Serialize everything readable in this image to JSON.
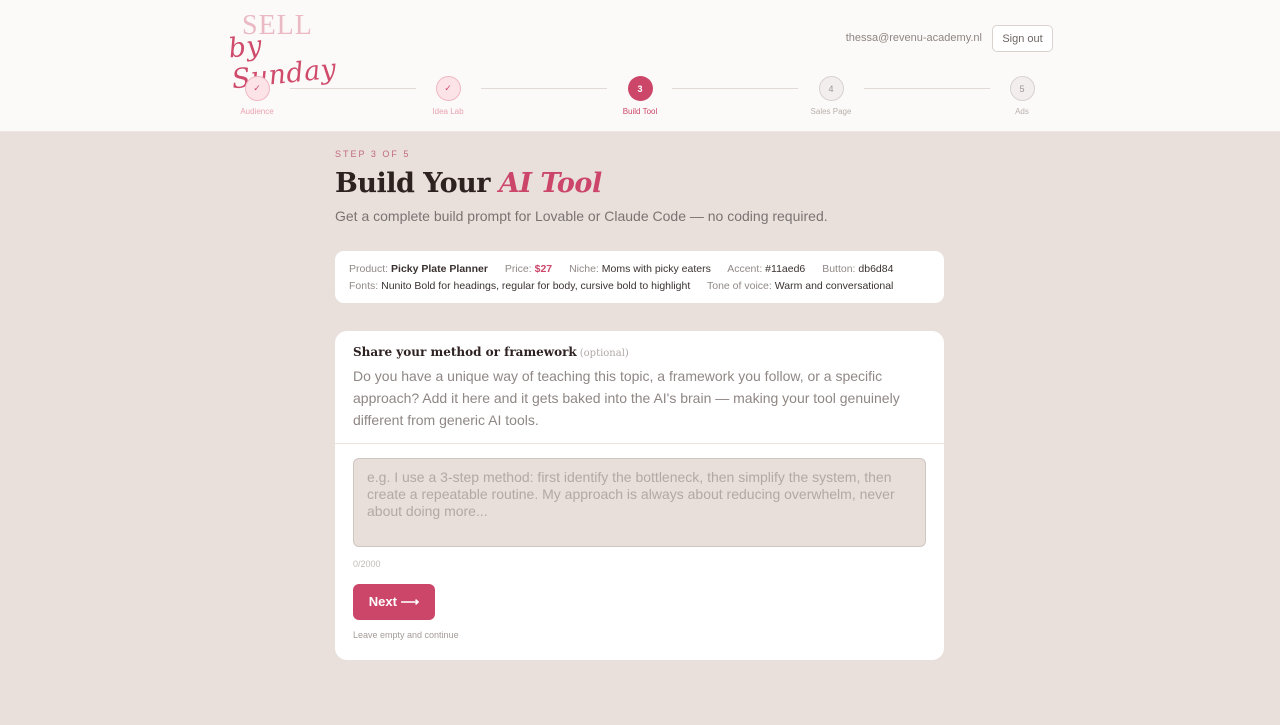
{
  "brand": {
    "line1": "SELL",
    "line2": "by Sunday"
  },
  "header": {
    "user_email": "thessa@revenu-academy.nl",
    "signout_label": "Sign out"
  },
  "steps": [
    {
      "number": "1",
      "label": "Audience",
      "status": "done",
      "icon": "check-icon"
    },
    {
      "number": "2",
      "label": "Idea Lab",
      "status": "done",
      "icon": "check-icon"
    },
    {
      "number": "3",
      "label": "Build Tool",
      "status": "active"
    },
    {
      "number": "4",
      "label": "Sales Page",
      "status": "todo"
    },
    {
      "number": "5",
      "label": "Ads",
      "status": "todo"
    }
  ],
  "page": {
    "eyebrow": "STEP 3 OF 5",
    "title_main": "Build Your",
    "title_accent": "AI Tool",
    "subtitle": "Get a complete build prompt for Lovable or Claude Code — no coding required."
  },
  "summary": {
    "product_label": "Product:",
    "product_value": "Picky Plate Planner",
    "price_label": "Price:",
    "price_value": "$27",
    "niche_label": "Niche:",
    "niche_value": "Moms with picky eaters",
    "accent_label": "Accent:",
    "accent_value": "#11aed6",
    "button_label": "Button:",
    "button_value": "db6d84",
    "fonts_label": "Fonts:",
    "fonts_value": "Nunito Bold for headings, regular for body, cursive bold to highlight",
    "tone_label": "Tone of voice:",
    "tone_value": "Warm and conversational"
  },
  "method_card": {
    "title": "Share your method or framework",
    "optional": "(optional)",
    "description": "Do you have a unique way of teaching this topic, a framework you follow, or a specific approach? Add it here and it gets baked into the AI's brain — making your tool genuinely different from generic AI tools.",
    "textarea_value": "",
    "textarea_placeholder": "e.g. I use a 3-step method: first identify the bottleneck, then simplify the system, then create a repeatable routine. My approach is always about reducing overwhelm, never about doing more...",
    "counter": "0/2000",
    "next_label": "Next ⟶",
    "skip_hint": "Leave empty and continue"
  },
  "colors": {
    "accent": "#cc4669",
    "background": "#e9e0dc",
    "header": "#fcfaf8"
  }
}
